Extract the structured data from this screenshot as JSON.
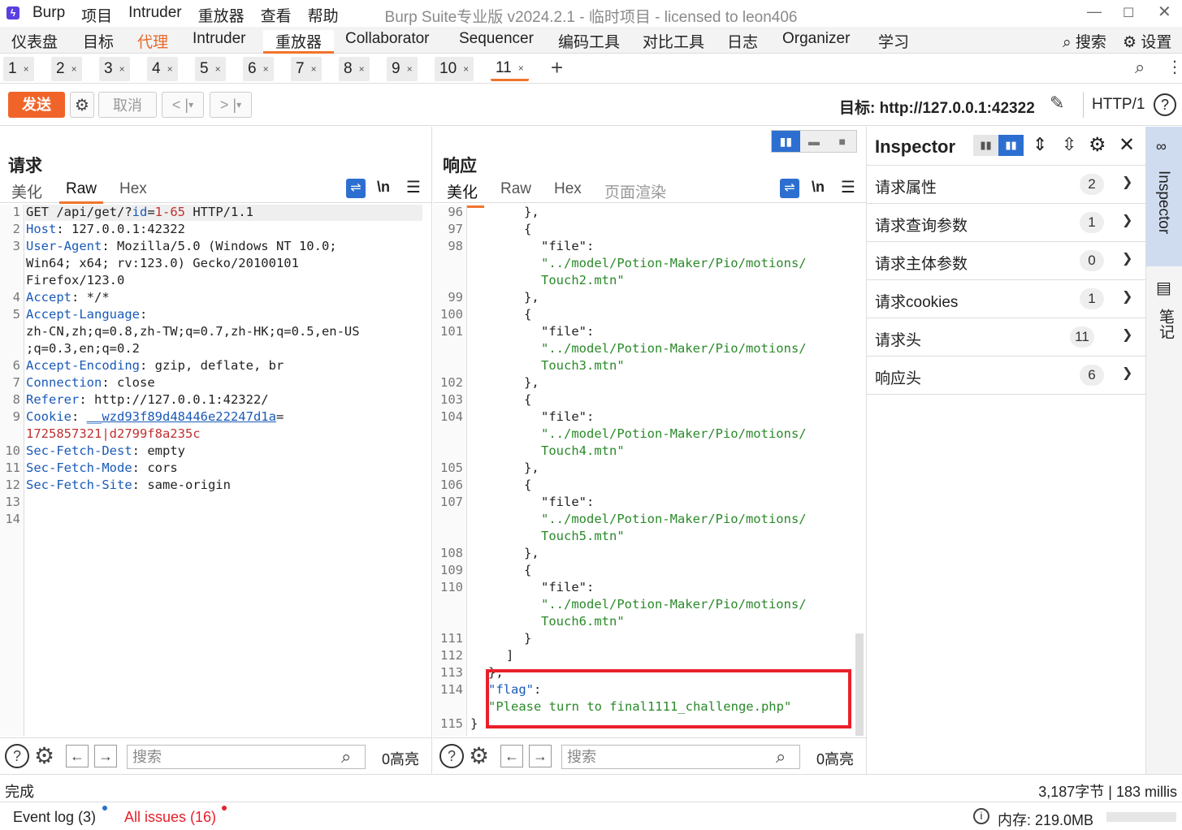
{
  "app": {
    "name": "Burp",
    "window_title": "Burp Suite专业版  v2024.2.1 - 临时项目 - licensed to leon406",
    "menu": [
      "项目",
      "Intruder",
      "重放器",
      "查看",
      "帮助"
    ]
  },
  "main_tabs": [
    "仪表盘",
    "目标",
    "代理",
    "Intruder",
    "重放器",
    "Collaborator",
    "Sequencer",
    "编码工具",
    "对比工具",
    "日志",
    "Organizer",
    "学习"
  ],
  "top_right": {
    "search": "搜索",
    "settings": "设置"
  },
  "repeater_tabs": [
    "1",
    "2",
    "3",
    "4",
    "5",
    "6",
    "7",
    "8",
    "9",
    "10",
    "11"
  ],
  "toolbar": {
    "send": "发送",
    "cancel": "取消",
    "target_label": "目标: http://127.0.0.1:42322",
    "protocol": "HTTP/1"
  },
  "request": {
    "title": "请求",
    "tabs": [
      "美化",
      "Raw",
      "Hex"
    ],
    "newline": "\\n"
  },
  "response": {
    "title": "响应",
    "tabs": [
      "美化",
      "Raw",
      "Hex",
      "页面渲染"
    ],
    "newline": "\\n"
  },
  "inspector": {
    "title": "Inspector",
    "rows": [
      {
        "label": "请求属性",
        "count": "2"
      },
      {
        "label": "请求查询参数",
        "count": "1"
      },
      {
        "label": "请求主体参数",
        "count": "0"
      },
      {
        "label": "请求cookies",
        "count": "1"
      },
      {
        "label": "请求头",
        "count": "11"
      },
      {
        "label": "响应头",
        "count": "6"
      }
    ]
  },
  "sidebar": {
    "inspector": "Inspector",
    "notes": "笔记"
  },
  "search_placeholder": "搜索",
  "highlights": "0高亮",
  "status": {
    "left": "完成",
    "right": "3,187字节 | 183 millis"
  },
  "footer": {
    "event_log": "Event log (3)",
    "issues": "All issues (16)",
    "memory": "内存: 219.0MB"
  }
}
